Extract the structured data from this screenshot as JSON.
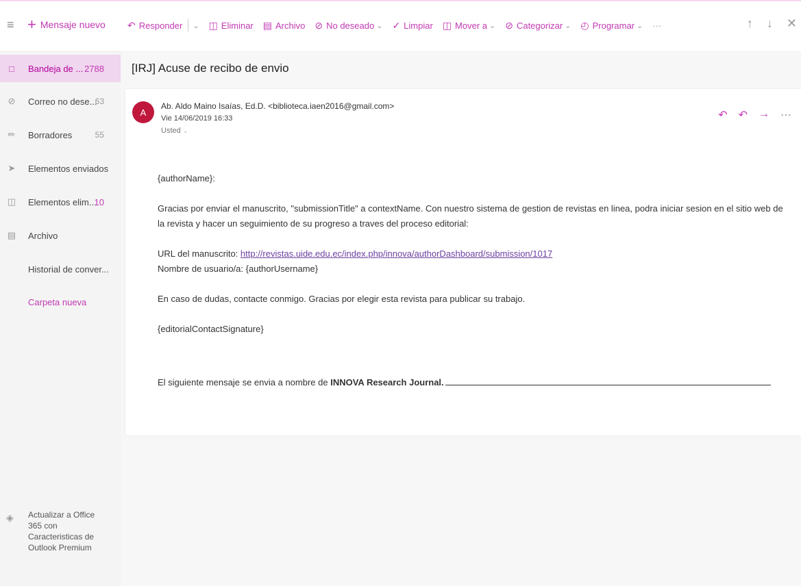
{
  "topbar": {
    "new_message": "Mensaje nuevo",
    "toolbar": {
      "reply": "Responder",
      "delete": "Eliminar",
      "archive": "Archivo",
      "junk": "No deseado",
      "sweep": "Limpiar",
      "move_to": "Mover a",
      "categorize": "Categorizar",
      "schedule": "Programar",
      "more": "···"
    }
  },
  "sidebar": {
    "items": [
      {
        "label": "Bandeja de ...",
        "count": "2788",
        "icon": "inbox-icon"
      },
      {
        "label": "Correo no dese...",
        "count": "63",
        "icon": "junk-icon"
      },
      {
        "label": "Borradores",
        "count": "55",
        "icon": "pencil-icon"
      },
      {
        "label": "Elementos enviados",
        "count": "",
        "icon": "send-icon"
      },
      {
        "label": "Elementos elim...",
        "count": "10",
        "icon": "trash-icon"
      },
      {
        "label": "Archivo",
        "count": "",
        "icon": "archive-icon"
      },
      {
        "label": "Historial de conver...",
        "count": "",
        "icon": ""
      },
      {
        "label": "Carpeta nueva",
        "count": "",
        "icon": ""
      }
    ],
    "upgrade": "Actualizar a Office 365 con Caracteristicas de Outlook Premium"
  },
  "message": {
    "subject": "[IRJ] Acuse de recibo de envio",
    "avatar_initial": "A",
    "sender": "Ab. Aldo Maino Isaías, Ed.D. <biblioteca.iaen2016@gmail.com>",
    "date": "Vie 14/06/2019 16:33",
    "to": "Usted",
    "greeting": "{authorName}:",
    "para1": "Gracias por enviar el manuscrito, \"submissionTitle\" a contextName. Con nuestro sistema de gestion de revistas en linea, podra iniciar sesion en el sitio web de la revista y hacer un seguimiento de su progreso a traves del proceso editorial:",
    "url_label": "URL del manuscrito: ",
    "url": "http://revistas.uide.edu.ec/index.php/innova/authorDashboard/submission/1017",
    "username": "Nombre de usuario/a: {authorUsername}",
    "para2": "En caso de dudas, contacte conmigo. Gracias por elegir esta revista para publicar su trabajo.",
    "signature": "{editorialContactSignature}",
    "footer_prefix": "El siguiente mensaje se envia a nombre de ",
    "footer_bold": "INNOVA Research Journal."
  },
  "colors": {
    "accent": "#c239b3",
    "selected_bg": "#f0d6ee",
    "avatar": "#c0183c"
  }
}
